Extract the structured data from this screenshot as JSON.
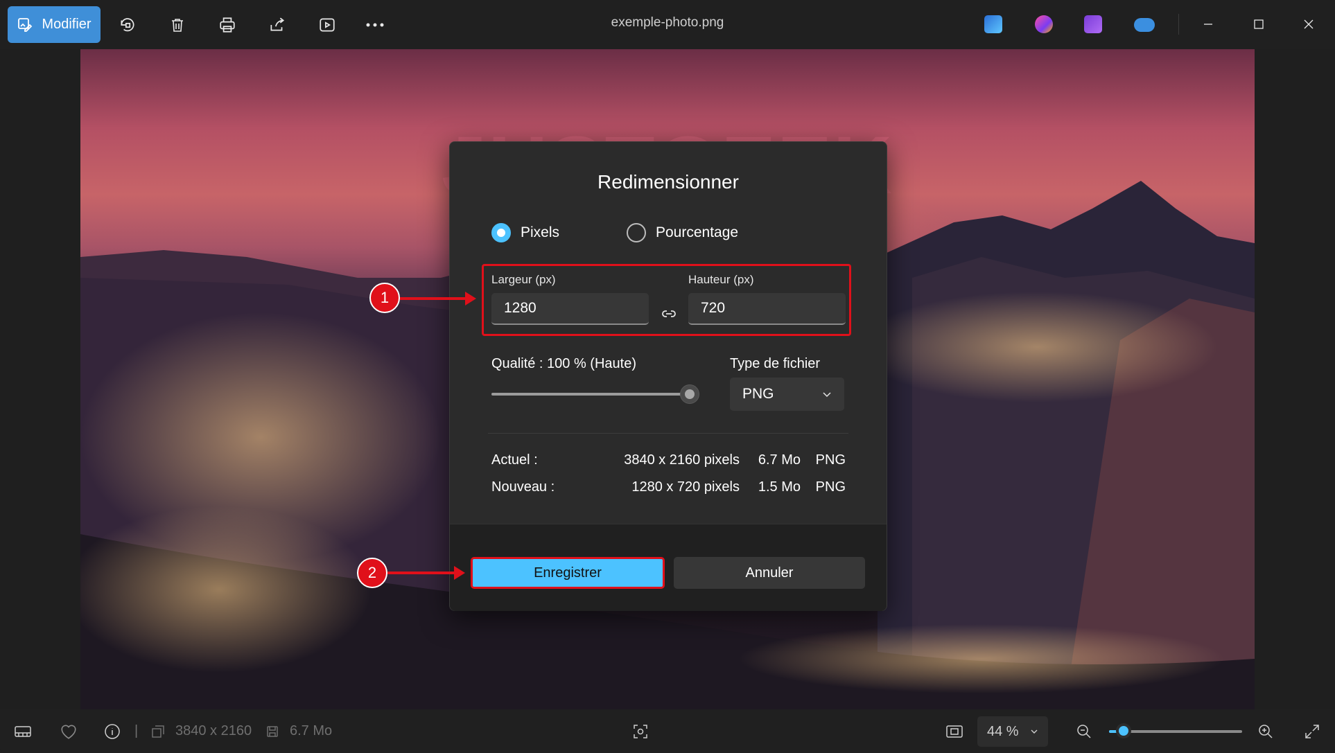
{
  "titlebar": {
    "edit_label": "Modifier",
    "filename": "exemple-photo.png",
    "toolbar_icons": [
      "rotate-icon",
      "delete-icon",
      "print-icon",
      "share-icon",
      "slideshow-icon",
      "more-icon"
    ],
    "app_icons": [
      "photo-editor-icon",
      "clipchamp-icon",
      "video-editor-icon",
      "onedrive-offline-icon"
    ],
    "window_controls": [
      "minimize-icon",
      "maximize-icon",
      "close-icon"
    ]
  },
  "photo": {
    "watermark": "JUSTGEEK"
  },
  "dialog": {
    "title": "Redimensionner",
    "radio_pixels": "Pixels",
    "radio_percent": "Pourcentage",
    "selected_mode": "Pixels",
    "width_label": "Largeur  (px)",
    "width_value": "1280",
    "height_label": "Hauteur  (px)",
    "height_value": "720",
    "quality_label": "Qualité : 100 % (Haute)",
    "quality_value": 1.0,
    "filetype_label": "Type de fichier",
    "filetype_value": "PNG",
    "current": {
      "label": "Actuel :",
      "dims": "3840 x 2160 pixels",
      "size": "6.7 Mo",
      "format": "PNG"
    },
    "new": {
      "label": "Nouveau :",
      "dims": "1280 x 720 pixels",
      "size": "1.5 Mo",
      "format": "PNG"
    },
    "save_label": "Enregistrer",
    "cancel_label": "Annuler"
  },
  "annotations": {
    "badge1": "1",
    "badge2": "2",
    "color": "#e0101a"
  },
  "statusbar": {
    "dims": "3840 x 2160",
    "size": "6.7 Mo",
    "zoom": "44 %",
    "separator": "|"
  },
  "colors": {
    "accent": "#4cc2ff",
    "edit_button": "#3f8fd8",
    "dialog_bg": "#2b2b2b"
  }
}
